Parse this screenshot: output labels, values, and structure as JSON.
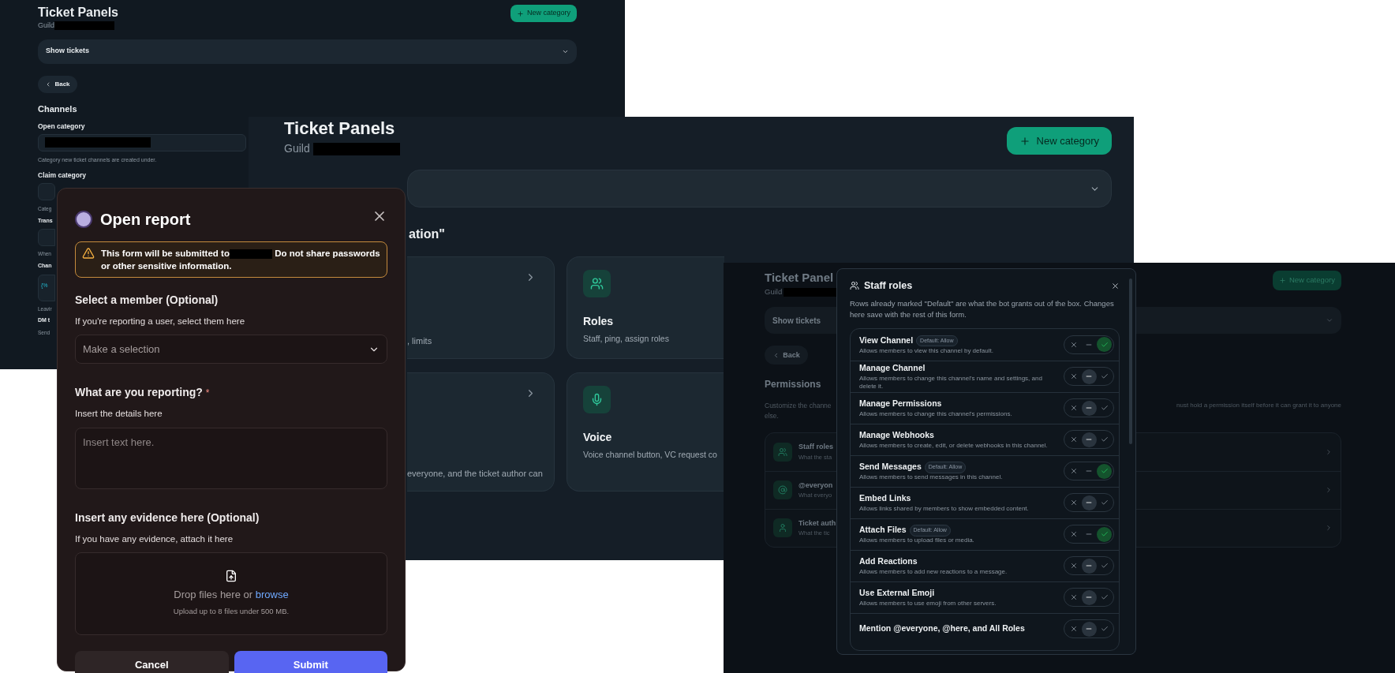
{
  "back_panel": {
    "title": "Ticket Panels",
    "guild_label": "Guild",
    "new_category": "New category",
    "dropdown": "Show tickets",
    "back": "Back",
    "section": "Channels",
    "fields": [
      {
        "label": "Open category",
        "hint": "Category new ticket channels are created under."
      },
      {
        "label": "Claim category"
      }
    ],
    "fragments": [
      {
        "kind": "hint",
        "text": "Categ"
      },
      {
        "kind": "label",
        "text": "Trans"
      },
      {
        "kind": "input"
      },
      {
        "kind": "hint",
        "text": "When"
      },
      {
        "kind": "label",
        "text": "Chan"
      },
      {
        "kind": "code",
        "text": "{%"
      },
      {
        "kind": "hint",
        "text": "Leavir"
      },
      {
        "kind": "label",
        "text": "DM t"
      },
      {
        "kind": "hint",
        "text": "Send"
      }
    ]
  },
  "middle_panel": {
    "title": "Ticket Panels",
    "guild_label": "Guild",
    "new_category": "New category",
    "heading": "ation\"",
    "cards": [
      {
        "kind": "link",
        "subtitle": ", limits"
      },
      {
        "kind": "roles",
        "title": "Roles",
        "subtitle": "Staff, ping, assign roles"
      },
      {
        "kind": "link",
        "subtitle": "everyone, and the ticket author can"
      },
      {
        "kind": "voice",
        "title": "Voice",
        "subtitle": "Voice channel button, VC request co"
      }
    ]
  },
  "report_dialog": {
    "title": "Open report",
    "warning_start": "This form will be submitted to",
    "warning_end": "Do not share passwords or other sensitive information.",
    "member": {
      "label": "Select a member (Optional)",
      "hint": "If you're reporting a user, select them here",
      "placeholder": "Make a selection"
    },
    "details": {
      "label": "What are you reporting?",
      "required_mark": "*",
      "hint": "Insert the details here",
      "placeholder": "Insert text here."
    },
    "evidence": {
      "label": "Insert any evidence here (Optional)",
      "hint": "If you have any evidence, attach it here",
      "drop_text": "Drop files here or",
      "link": "browse",
      "limit": "Upload up to 8 files under 500 MB."
    },
    "buttons": {
      "cancel": "Cancel",
      "submit": "Submit"
    }
  },
  "right_panel": {
    "title": "Ticket Panel",
    "guild_label": "Guild",
    "new_category": "New category",
    "dropdown": "Show tickets",
    "back": "Back",
    "section": "Permissions",
    "description_left": "Customize the channe",
    "description_left_end": "else.",
    "description_right": "nust hold a permission itself before it can grant it to anyone",
    "rows": [
      {
        "kind": "staff",
        "title": "Staff roles",
        "subtitle": "What the sta"
      },
      {
        "kind": "everyone",
        "title": "@everyon",
        "subtitle": "What everyo"
      },
      {
        "kind": "author",
        "title": "Ticket auth",
        "subtitle": "What the tic"
      }
    ]
  },
  "staff_modal": {
    "title": "Staff roles",
    "description": "Rows already marked \"Default\" are what the bot grants out of the box. Changes here save with the rest of this form.",
    "permissions": [
      {
        "name": "View Channel",
        "badge": "Default: Allow",
        "description": "Allows members to view this channel by default.",
        "deny": false,
        "neutral": false,
        "allow": true
      },
      {
        "name": "Manage Channel",
        "description": "Allows members to change this channel's name and settings, and delete it.",
        "deny": false,
        "neutral": true,
        "allow": false
      },
      {
        "name": "Manage Permissions",
        "description": "Allows members to change this channel's permissions.",
        "deny": false,
        "neutral": true,
        "allow": false
      },
      {
        "name": "Manage Webhooks",
        "description": "Allows members to create, edit, or delete webhooks in this channel.",
        "deny": false,
        "neutral": true,
        "allow": false
      },
      {
        "name": "Send Messages",
        "badge": "Default: Allow",
        "description": "Allows members to send messages in this channel.",
        "deny": false,
        "neutral": false,
        "allow": true
      },
      {
        "name": "Embed Links",
        "description": "Allows links shared by members to show embedded content.",
        "deny": false,
        "neutral": true,
        "allow": false
      },
      {
        "name": "Attach Files",
        "badge": "Default: Allow",
        "description": "Allows members to upload files or media.",
        "deny": false,
        "neutral": false,
        "allow": true
      },
      {
        "name": "Add Reactions",
        "description": "Allows members to add new reactions to a message.",
        "deny": false,
        "neutral": true,
        "allow": false
      },
      {
        "name": "Use External Emoji",
        "description": "Allows members to use emoji from other servers.",
        "deny": false,
        "neutral": true,
        "allow": false
      },
      {
        "name": "Mention @everyone, @here, and All Roles",
        "deny": false,
        "neutral": true,
        "allow": false
      }
    ]
  }
}
